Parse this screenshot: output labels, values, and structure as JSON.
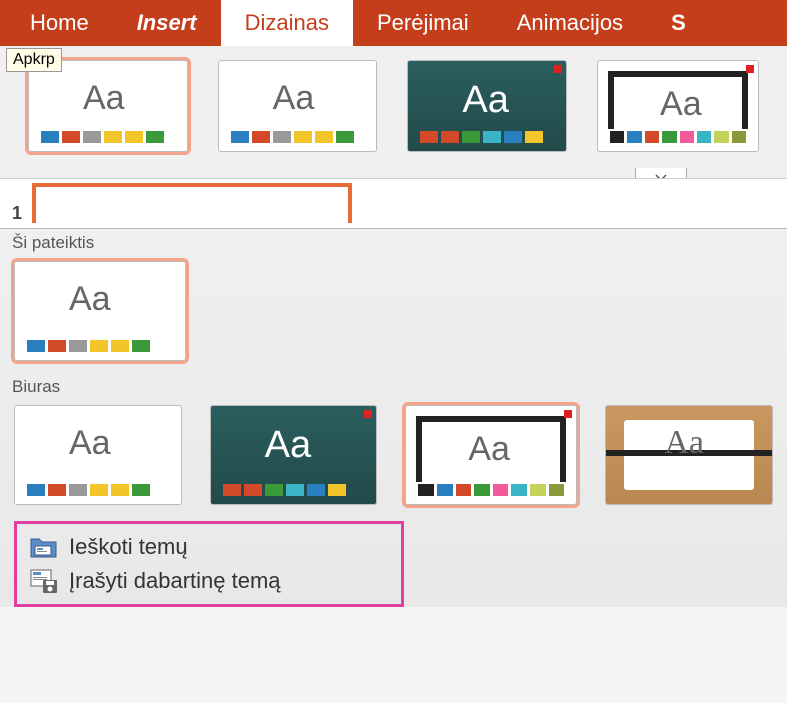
{
  "tabs": {
    "home": "Home",
    "insert": "Insert",
    "design": "Dizainas",
    "transitions": "Perėjimai",
    "animations": "Animacijos",
    "last": "S"
  },
  "tooltip": "Apkrp",
  "aa": "Aa",
  "slide_number": "1",
  "dropdown": {
    "section1": "Ši pateiktis",
    "section2": "Biuras",
    "menu": {
      "browse": "Ieškoti temų",
      "save": "Įrašyti dabartinę temą"
    }
  }
}
